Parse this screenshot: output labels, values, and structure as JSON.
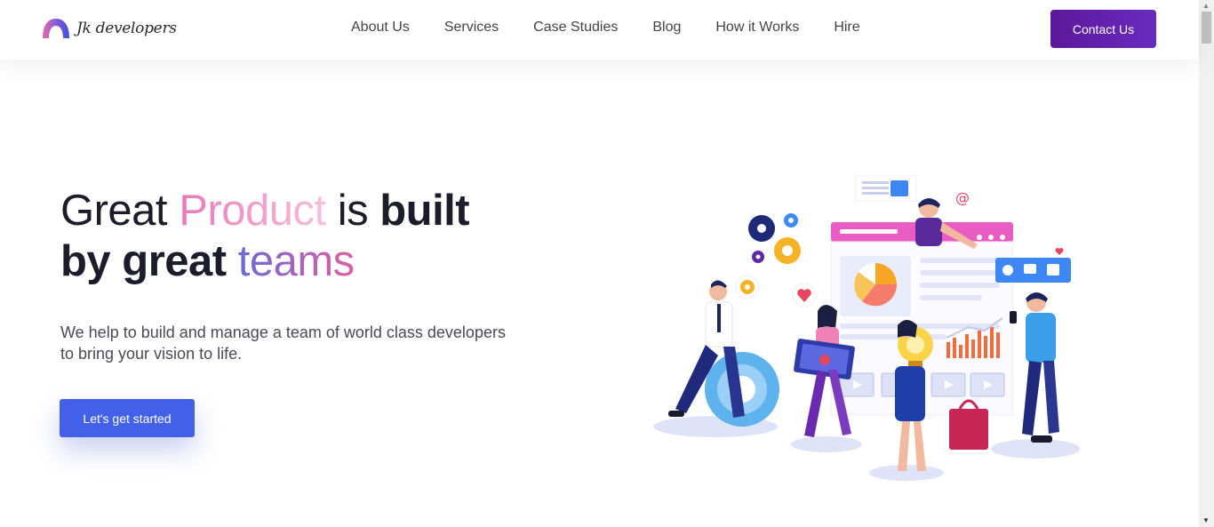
{
  "brand": {
    "logo_text": "Jk developers",
    "logo_icon": "arch-logo-icon"
  },
  "nav": {
    "links": [
      "About Us",
      "Services",
      "Case Studies",
      "Blog",
      "How it Works",
      "Hire"
    ],
    "contact_label": "Contact Us"
  },
  "hero": {
    "title": {
      "w1": "Great",
      "w2": "Product",
      "w3": "is",
      "w4": "built",
      "w5": "by great",
      "w6": "teams"
    },
    "subtitle_line1": "We help to build and manage a team of world class developers",
    "subtitle_line2": "to bring your vision to life.",
    "cta_label": "Let's get started"
  },
  "illustration": {
    "description_icon": "team-collaboration-illustration",
    "badge_at": "@"
  },
  "colors": {
    "accent_purple": "#5a189a",
    "cta_blue": "#4360e8",
    "pink": "#e879b9",
    "violet": "#6a6ad8"
  }
}
